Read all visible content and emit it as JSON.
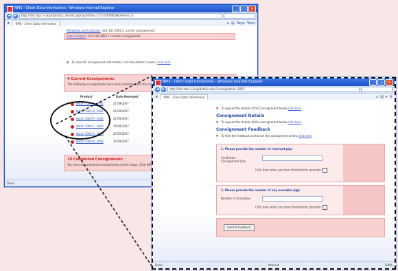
{
  "window_back": {
    "title": "NPIS - Client Data Information - Windows Internet Explorer",
    "address": "http://dist.ntpc.nl.org/statistics_details.aspx?portfolio=127-10738824&referrer=0",
    "tab": "NPIS - Client Data Information",
    "toolbar": [
      "Page",
      "Tools"
    ],
    "summary_rows": [
      {
        "label": "Marketing and Customer",
        "values": "201-101  2002  4  current consignments"
      },
      {
        "label": "Sales Analysis",
        "values": "201-101  2003  1  current consignments"
      }
    ],
    "view_note": "To view full consignment information click the details column.",
    "view_note_link": "click here",
    "current_header": "4 Current Consignments",
    "current_desc": "The following consignments have been collected from the client and are awaiting your feedback.",
    "col_product": "Product",
    "col_date": "Date Received",
    "consignments": [
      {
        "link": "Batch 1001-A, 2001",
        "date": "21/09/2007"
      },
      {
        "link": "Batch 1002-B, 2001",
        "date": "21/09/2007"
      },
      {
        "link": "Batch 1003-A, 2002",
        "date": "21/09/2007"
      },
      {
        "link": "Batch 1004-C, 2002",
        "date": "25/09/2007"
      },
      {
        "link": "Batch 1005-A, 2003",
        "date": "25/09/2007"
      },
      {
        "link": "Batch 1006-B, 2003",
        "date": "25/09/2007"
      }
    ],
    "completed_header": "10 Completed Consignments",
    "completed_desc": "You have no completed consignments at this stage. Click NPIS Data page.",
    "status": "Done"
  },
  "window_front": {
    "title": "NPIS - Client Data Information - Windows Internet Explorer",
    "address": "http://dist.ntpc.nl.org/details.aspx?consignment=1001",
    "tab": "NPIS - Client Data Information",
    "expand_all_text": "To expand the details of the consignment below",
    "expand_all_link": "click here",
    "section1_title": "Consignment Details",
    "section1_text": "To expand the details of the consignment below",
    "section1_link": "click here",
    "section2_title": "Consignment Feedback",
    "section2_text": "To hide the feedback section of this consignment below",
    "section2_link": "click here",
    "q1_title": "1. Please provide the number of received pigs",
    "q1_field_label": "Confirmed Consignment Size",
    "q1_confirm": "Click here when you have finished this question",
    "q2_title": "2. Please provide the number of any unusable pigs",
    "q2_field_label": "Number of Unusables",
    "q2_confirm": "Click here when you have finished this question",
    "submit_label": "Submit Feedback",
    "status_left": "Done",
    "status_mid": "Internet",
    "status_zoom": "100%"
  }
}
